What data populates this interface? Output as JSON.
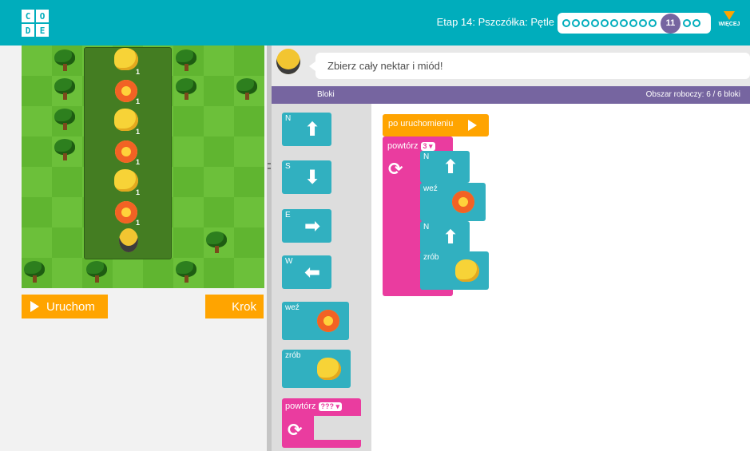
{
  "header": {
    "logo_letters": [
      "C",
      "O",
      "D",
      "E"
    ],
    "level_title": "Etap 14: Pszczółka: Pętle",
    "progress": {
      "before": 10,
      "current": "11",
      "after": 2
    },
    "more_label": "WIĘCEJ"
  },
  "game": {
    "run_label": "Uruchom",
    "step_label": "Krok",
    "counts": [
      "1",
      "1",
      "1",
      "1",
      "1",
      "1"
    ]
  },
  "instruction": "Zbierz cały nektar i miód!",
  "toolbox": {
    "header": "Bloki",
    "dirs": [
      "N",
      "S",
      "E",
      "W"
    ],
    "take_label": "weź",
    "make_label": "zrób",
    "repeat_label": "powtórz",
    "repeat_value": "???"
  },
  "workspace": {
    "header": "Obszar roboczy: 6 / 6 bloki",
    "when_run": "po uruchomieniu",
    "repeat_label": "powtórz",
    "repeat_value": "3",
    "n1": "N",
    "take_label": "weź",
    "n2": "N",
    "make_label": "zrób"
  },
  "colors": {
    "header": "#00adbc",
    "accent": "#ffa400",
    "purple": "#7665a0",
    "block": "#31b0c0",
    "loop": "#ea3c9f"
  },
  "icons": [
    "play-icon",
    "up-arrow-icon",
    "down-arrow-icon",
    "right-arrow-icon",
    "left-arrow-icon",
    "loop-icon",
    "flower-icon",
    "honeycomb-icon",
    "bee-icon",
    "tree-icon"
  ]
}
